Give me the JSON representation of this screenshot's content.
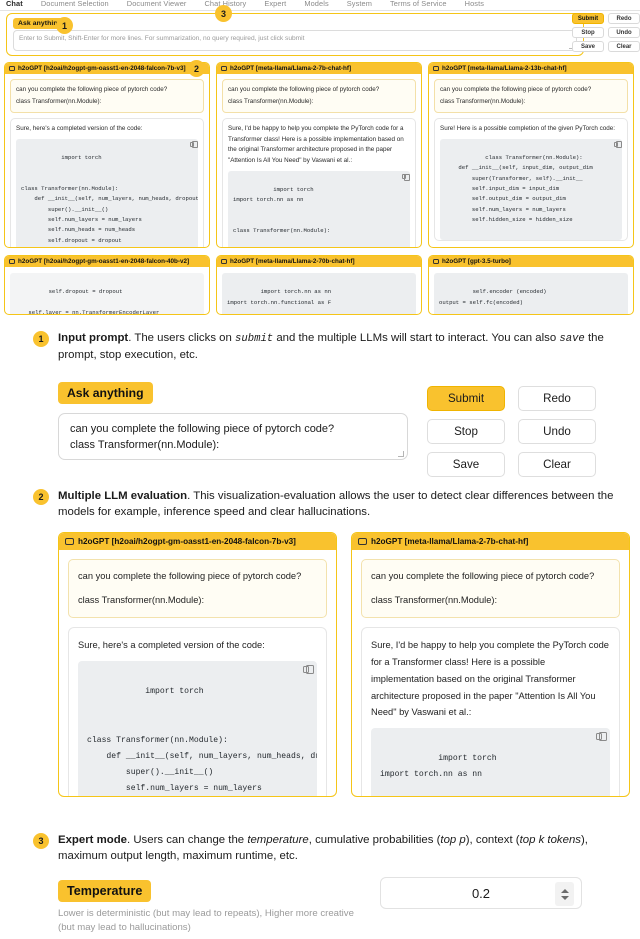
{
  "app": {
    "tabs": [
      {
        "label": "Chat",
        "active": true
      },
      {
        "label": "Document Selection",
        "active": false
      },
      {
        "label": "Document Viewer",
        "active": false
      },
      {
        "label": "Chat History",
        "active": false
      },
      {
        "label": "Expert",
        "active": false
      },
      {
        "label": "Models",
        "active": false
      },
      {
        "label": "System",
        "active": false
      },
      {
        "label": "Terms of Service",
        "active": false
      },
      {
        "label": "Hosts",
        "active": false
      }
    ]
  },
  "prompt": {
    "chip_label": "Ask anything",
    "placeholder": "Enter to Submit, Shift-Enter for more lines.  For summarization, no query required, just click submit",
    "value_line1": "can you complete the following piece of pytorch code?",
    "value_line2": "class Transformer(nn.Module):"
  },
  "buttons": {
    "submit": "Submit",
    "redo": "Redo",
    "stop": "Stop",
    "undo": "Undo",
    "save": "Save",
    "clear": "Clear"
  },
  "callouts": {
    "one": "1",
    "two": "2",
    "three": "3"
  },
  "screenshot_panels": {
    "row1": [
      {
        "title": "h2oGPT [h2oai/h2ogpt-gm-oasst1-en-2048-falcon-7b-v3]",
        "user_line1": "can you complete the following piece of pytorch code?",
        "user_line2": "class Transformer(nn.Module):",
        "intro": "Sure, here's a completed version of the code:",
        "code": "import torch\n\n\nclass Transformer(nn.Module):\n    def __init__(self, num_layers, num_heads, dropout=0.1):\n        super().__init__()\n        self.num_layers = num_layers\n        self.num_heads = num_heads\n        self.dropout = dropout"
      },
      {
        "title": "h2oGPT [meta-llama/Llama-2-7b-chat-hf]",
        "user_line1": "can you complete the following piece of pytorch code?",
        "user_line2": "class Transformer(nn.Module):",
        "intro": "Sure, I'd be happy to help you complete the PyTorch code for a Transformer class! Here is a possible implementation based on the original Transformer architecture proposed in the paper \"Attention Is All You Need\" by Vaswani et al.:",
        "code": "import torch\nimport torch.nn as nn\n\n\nclass Transformer(nn.Module):"
      },
      {
        "title": "h2oGPT [meta-llama/Llama-2-13b-chat-hf]",
        "user_line1": "can you complete the following piece of pytorch code?",
        "user_line2": "class Transformer(nn.Module):",
        "intro": "Sure! Here is a possible completion of the given PyTorch code:",
        "code": "class Transformer(nn.Module):\n    def __init__(self, input_dim, output_dim\n        super(Transformer, self).__init__\n        self.input_dim = input_dim\n        self.output_dim = output_dim\n        self.num_layers = num_layers\n        self.hidden_size = hidden_size"
      }
    ],
    "row2": [
      {
        "title": "h2oGPT [h2oai/h2ogpt-gm-oasst1-en-2048-falcon-40b-v2]",
        "code": "self.dropout = dropout\n\n    self.layer = nn.TransformerEncoderLayer\n    self.transformer_encoder = nn.Transform"
      },
      {
        "title": "h2oGPT [meta-llama/Llama-2-70b-chat-hf]",
        "code": "import torch.nn as nn\nimport torch.nn.functional as F\n\n\nclass Transformer(nn.Module):"
      },
      {
        "title": "h2oGPT [gpt-3.5-turbo]",
        "code": "self.encoder (encoded)\noutput = self.fc(encoded)\n\n\nreturn output"
      }
    ]
  },
  "annotations": {
    "one": {
      "number": "1",
      "title": "Input prompt",
      "body_a": ". The users clicks on ",
      "code_1": "submit",
      "body_b": " and the multiple LLMs will start to interact. You can also ",
      "code_2": "save",
      "body_c": " the prompt, stop execution, etc."
    },
    "two": {
      "number": "2",
      "title": "Multiple LLM evaluation",
      "body": ". This visualization-evaluation allows the user to detect clear differences  between the models for example, inference speed and clear hallucinations."
    },
    "three": {
      "number": "3",
      "title": "Expert mode",
      "body_a": ". Users can change the ",
      "em_1": "temperature",
      "body_b": ", cumulative probabilities (",
      "em_2": "top p",
      "body_c": "), context (",
      "em_3": "top k tokens",
      "body_d": "), maximum output length, maximum runtime, etc."
    }
  },
  "detail_panels": [
    {
      "title": "h2oGPT [h2oai/h2ogpt-gm-oasst1-en-2048-falcon-7b-v3]",
      "user_line1": "can you complete the following piece of pytorch code?",
      "user_line2": "class Transformer(nn.Module):",
      "intro": "Sure, here's a completed version of the code:",
      "code": "import torch\n\n\nclass Transformer(nn.Module):\n    def __init__(self, num_layers, num_heads, dropout=0.1\n        super().__init__()\n        self.num_layers = num_layers\n        self.num_heads = num_heads"
    },
    {
      "title": "h2oGPT [meta-llama/Llama-2-7b-chat-hf]",
      "user_line1": "can you complete the following piece of pytorch code?",
      "user_line2": "class Transformer(nn.Module):",
      "intro": "Sure, I'd be happy to help you complete the PyTorch code for a Transformer class! Here is a possible implementation based on the original Transformer architecture proposed in the paper \"Attention Is All You Need\" by Vaswani et al.:",
      "code": "import torch\nimport torch.nn as nn"
    }
  ],
  "temperature": {
    "chip_label": "Temperature",
    "help_text": "Lower is deterministic (but may lead to repeats), Higher more creative (but may lead to hallucinations)",
    "value": "0.2"
  },
  "colors": {
    "accent": "#f9c22e",
    "accent_border": "#f5c518",
    "code_bg": "#eceef0",
    "user_bubble_bg": "#fffdf4"
  }
}
